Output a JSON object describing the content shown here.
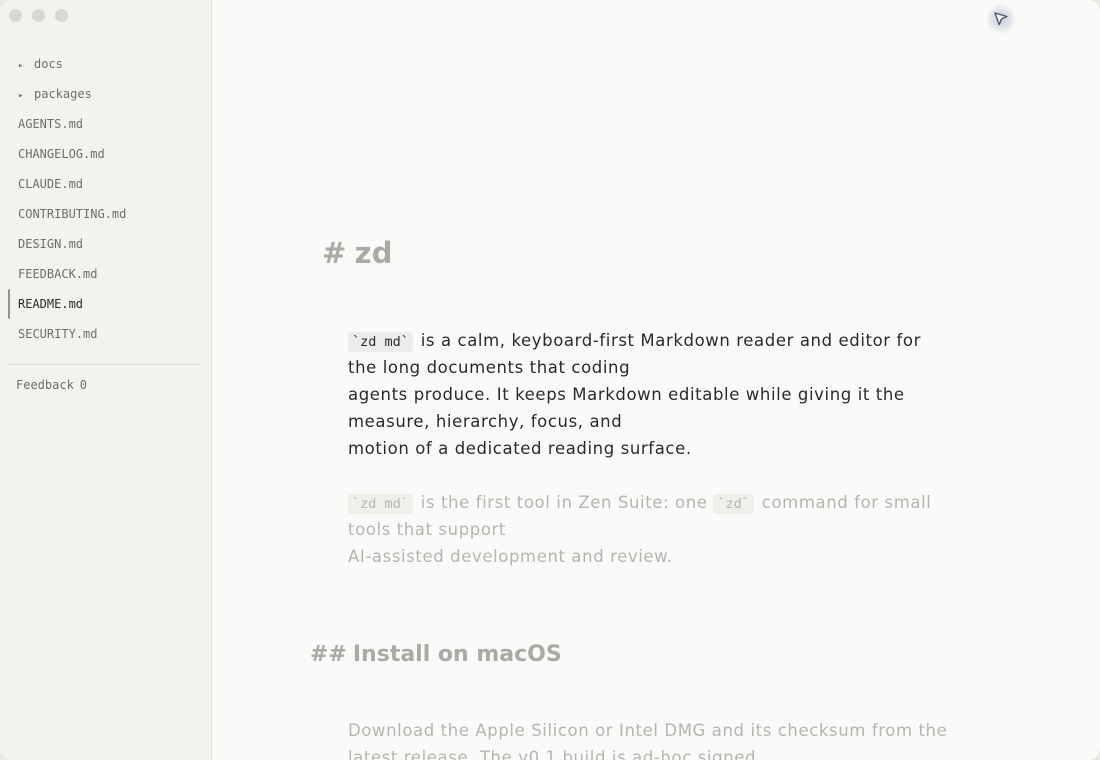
{
  "sidebar": {
    "folders": [
      {
        "caret": "▸",
        "label": "docs"
      },
      {
        "caret": "▸",
        "label": "packages"
      }
    ],
    "files": [
      {
        "label": "AGENTS.md"
      },
      {
        "label": "CHANGELOG.md"
      },
      {
        "label": "CLAUDE.md"
      },
      {
        "label": "CONTRIBUTING.md"
      },
      {
        "label": "DESIGN.md"
      },
      {
        "label": "FEEDBACK.md"
      },
      {
        "label": "README.md"
      },
      {
        "label": "SECURITY.md"
      }
    ],
    "active_file": "README.md",
    "feedback": {
      "label": "Feedback",
      "count": "0"
    }
  },
  "document": {
    "h1": {
      "marker": "#",
      "text": "zd"
    },
    "p1": {
      "code": "`zd md`",
      "line1_rest": " is a calm, keyboard-first Markdown reader and editor for",
      "line2": "the long documents that coding",
      "line3": "agents produce. It keeps Markdown editable while giving it the",
      "line4": "measure, hierarchy, focus, and",
      "line5": "motion of a dedicated reading surface."
    },
    "p2": {
      "code1": "`zd md`",
      "text1": " is the first tool in Zen Suite: one ",
      "code2": "`zd`",
      "text2": " command for small",
      "line2": "tools that support",
      "line3": "AI-assisted development and review."
    },
    "h2": {
      "marker": "##",
      "text": "Install on macOS"
    },
    "p3": {
      "line1": "Download the Apple Silicon or Intel DMG and its checksum from the",
      "line2": "latest release. The v0.1 build is ad-hoc signed"
    }
  },
  "colors": {
    "sidebar_bg": "#f2f2ef",
    "main_bg": "#fafaf8",
    "active_indicator": "#8f959b",
    "heading_dim": "#a9a9a6",
    "text_focus": "#2a2a28",
    "text_dim": "#b4b4b1"
  },
  "icons": {
    "window_controls": "traffic-light-dots",
    "pointer": "cursor-arrow-icon"
  }
}
